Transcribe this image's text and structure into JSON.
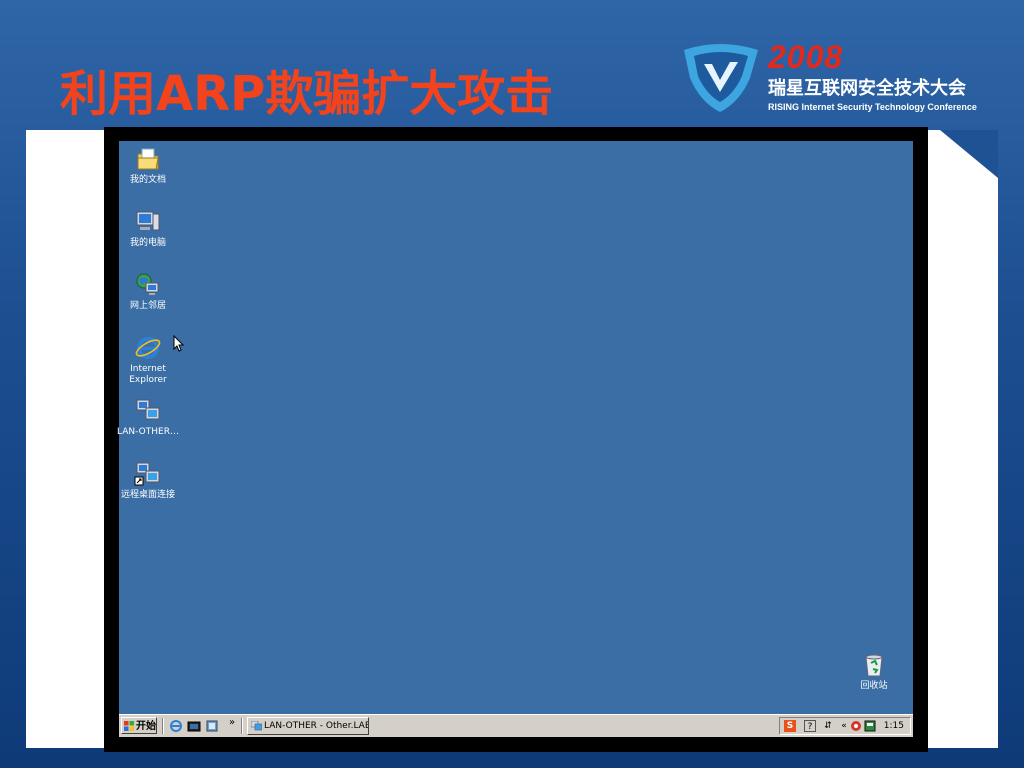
{
  "slide": {
    "title": "利用ARP欺骗扩大攻击",
    "logo_year": "2008",
    "logo_cn": "瑞星互联网安全技术大会",
    "logo_en": "RISING Internet Security Technology Conference"
  },
  "desktop": {
    "background_color": "#3a6ea5",
    "icons": [
      {
        "label": "我的文档",
        "icon": "my-documents-icon"
      },
      {
        "label": "我的电脑",
        "icon": "my-computer-icon"
      },
      {
        "label": "网上邻居",
        "icon": "network-places-icon"
      },
      {
        "label": "Internet Explorer",
        "icon": "internet-explorer-icon"
      },
      {
        "label": "LAN-OTHER…",
        "icon": "remote-desktop-icon"
      },
      {
        "label": "远程桌面连接",
        "icon": "remote-desktop-shortcut-icon"
      }
    ],
    "recycle_bin": {
      "label": "回收站",
      "icon": "recycle-bin-icon"
    }
  },
  "taskbar": {
    "start_label": "开始",
    "quicklaunch_more": "»",
    "task_button": "LAN-OTHER - Other.LAB…",
    "tray_chevron": "«",
    "clock": "1:15"
  }
}
